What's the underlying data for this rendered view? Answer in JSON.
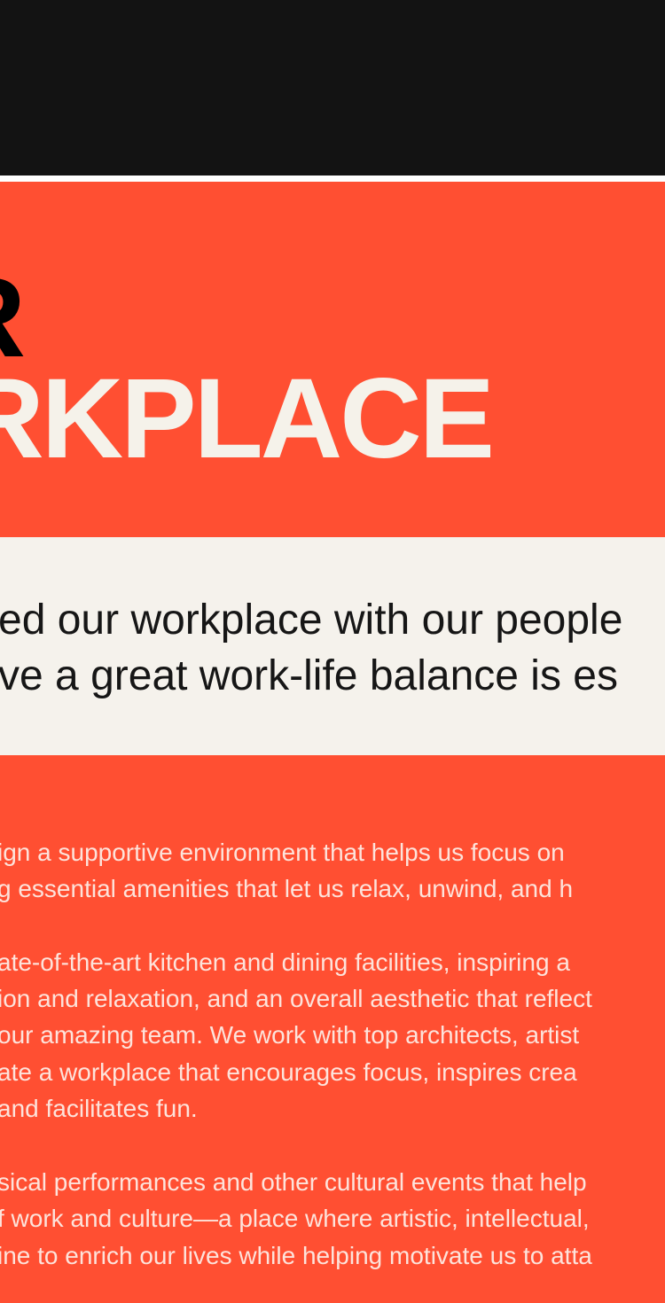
{
  "hero": {
    "line1": "R",
    "line2": "RKPLACE"
  },
  "intro": {
    "line1": "ed our workplace with our people",
    "line2": "ve a great work-life balance is es"
  },
  "body": {
    "paragraph1": [
      "ign a supportive environment that helps us focus on",
      "g essential amenities that let us relax, unwind, and h"
    ],
    "paragraph2": [
      "ate-of-the-art kitchen and dining facilities, inspiring a",
      "ion and relaxation, and an overall aesthetic that reflect",
      "our amazing team. We work with top architects, artist",
      "ate a workplace that encourages focus, inspires crea",
      "and facilitates fun."
    ],
    "paragraph3": [
      "sical performances and other cultural events that help",
      "f work and culture—a place where artistic, intellectual,",
      "ine to enrich our lives while helping motivate us to atta"
    ]
  },
  "colors": {
    "dark": "#131313",
    "accent": "#ff4f32",
    "cream": "#f5f2ec"
  }
}
